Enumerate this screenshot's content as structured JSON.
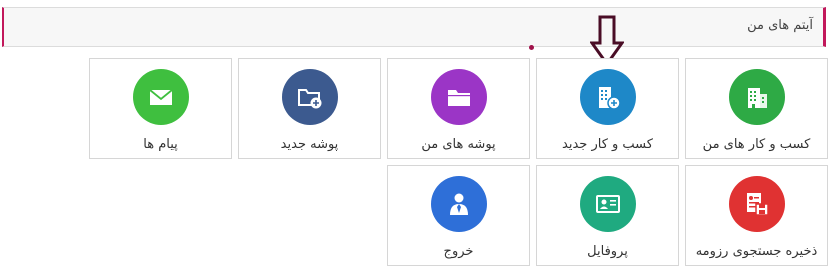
{
  "header": {
    "title": "آیتم های من"
  },
  "tiles": [
    {
      "label": "کسب و کار های من",
      "icon": "buildings-icon",
      "color": "#2eaa45"
    },
    {
      "label": "کسب و کار جدید",
      "icon": "building-add-icon",
      "color": "#1e88c8"
    },
    {
      "label": "پوشه های من",
      "icon": "folder-icon",
      "color": "#9b35c6"
    },
    {
      "label": "پوشه جدید",
      "icon": "folder-add-icon",
      "color": "#3c5a8f"
    },
    {
      "label": "پیام ها",
      "icon": "envelope-icon",
      "color": "#3fbf3f"
    },
    {
      "label": "ذخیره جستجوی رزومه",
      "icon": "resume-save-icon",
      "color": "#e03232"
    },
    {
      "label": "پروفایل",
      "icon": "id-card-icon",
      "color": "#1faa80"
    },
    {
      "label": "خروج",
      "icon": "logout-user-icon",
      "color": "#2e6fd8"
    }
  ]
}
